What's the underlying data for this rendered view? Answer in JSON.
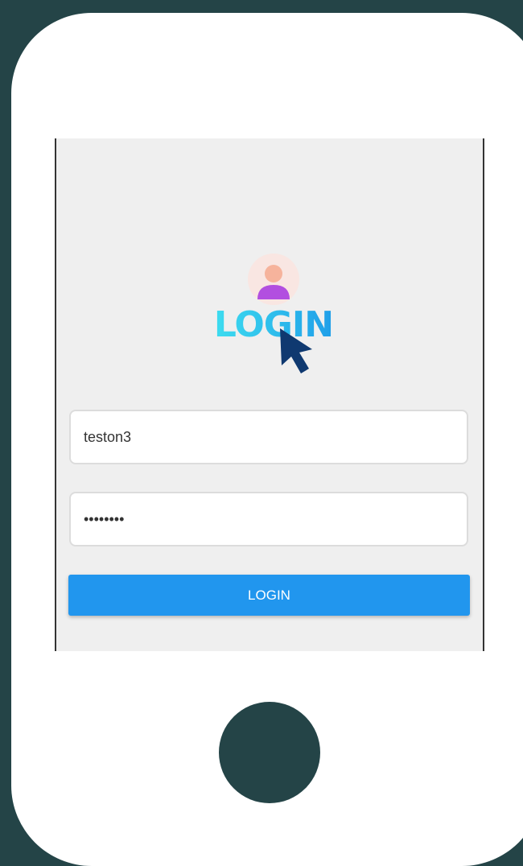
{
  "logo": {
    "text": "LOGIN"
  },
  "form": {
    "username_value": "teston3",
    "password_value": "••••••••",
    "login_label": "LOGIN"
  },
  "colors": {
    "background": "#244447",
    "button": "#2196ee",
    "logo_gradient": [
      "#3fe0f0",
      "#1e9be8"
    ]
  }
}
